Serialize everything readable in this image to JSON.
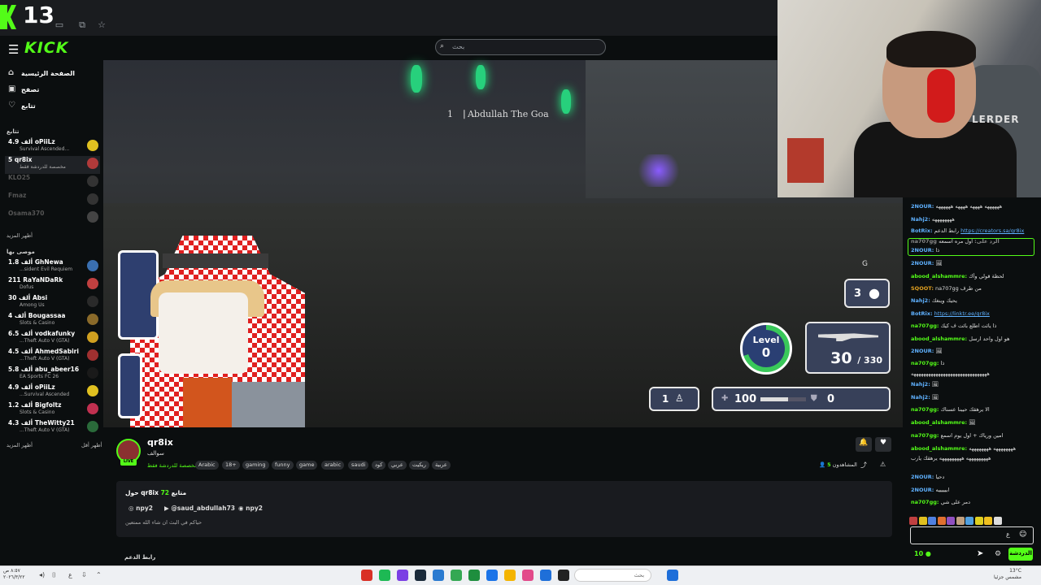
{
  "browser": {
    "tab_count": "13"
  },
  "header": {
    "logo": "KICK",
    "search_placeholder": "بحث"
  },
  "sidebar": {
    "nav": [
      {
        "label": "الصفحة الرئيسية",
        "icon": "home-icon"
      },
      {
        "label": "تصفح",
        "icon": "browse-icon"
      },
      {
        "label": "تتابع",
        "icon": "heart-icon"
      }
    ],
    "following_title": "تتابع",
    "following": [
      {
        "name": "4.9 ألف oPiiLz",
        "category": "Survival Ascended...",
        "avatar_color": "#e0c020",
        "offline": false,
        "selected": false
      },
      {
        "name": "5 qr8ix",
        "category": "مخصصة للدردشة فقط",
        "avatar_color": "#b03a3a",
        "offline": false,
        "selected": true
      },
      {
        "name": "KLO25",
        "category": "",
        "avatar_color": "#333",
        "offline": true,
        "selected": false
      },
      {
        "name": "Fmaz",
        "category": "",
        "avatar_color": "#333",
        "offline": true,
        "selected": false
      },
      {
        "name": "Osama370",
        "category": "",
        "avatar_color": "#444",
        "offline": true,
        "selected": false
      }
    ],
    "show_more_1": "أظهر المزيد",
    "recommended_title": "موصى بها",
    "recommended": [
      {
        "name": "1.8 ألف GhNewa",
        "category": "...sident Evil Requiem",
        "avatar_color": "#3a6fb0"
      },
      {
        "name": "211 RaYaNDaRk",
        "category": "Dofus",
        "avatar_color": "#c04040"
      },
      {
        "name": "30 ألف Absi",
        "category": "Among Us",
        "avatar_color": "#2a2a2a"
      },
      {
        "name": "4 ألف Bougassaa",
        "category": "Slots & Casino",
        "avatar_color": "#8a6a2a"
      },
      {
        "name": "6.5 ألف vodkafunky",
        "category": "...Theft Auto V (GTA)",
        "avatar_color": "#d0a020"
      },
      {
        "name": "4.5 ألف AhmedSabiri",
        "category": "...Theft Auto V (GTA)",
        "avatar_color": "#a03030"
      },
      {
        "name": "5.8 ألف abu_abeer16",
        "category": "EA Sports FC 26",
        "avatar_color": "#1a1a1a"
      },
      {
        "name": "4.9 ألف oPiiLz",
        "category": "...Survival Ascended",
        "avatar_color": "#e0c020"
      },
      {
        "name": "1.2 ألف Bigfoltz",
        "category": "Slots & Casino",
        "avatar_color": "#c03050"
      },
      {
        "name": "4.3 ألف TheWitty21",
        "category": "...Theft Auto V (GTA)",
        "avatar_color": "#2a6a3a"
      }
    ],
    "show_more_2": "أظهر المزيد",
    "show_less": "أظهر أقل"
  },
  "video": {
    "killfeed": "1 ⎹  Abdullah The Goa",
    "g_key": "G",
    "grenades": "3",
    "level_label": "Level",
    "level_value": "0",
    "level_progress": 0.7,
    "ammo": "30",
    "ammo_reserve": "/ 330",
    "team_count": "1",
    "health": "100",
    "health_fraction": 0.6,
    "armor": "0"
  },
  "channel": {
    "name": "qr8ix",
    "live_badge": "LIVE",
    "title": "سوالف",
    "category": "مخصصة للدردشة فقط",
    "tags": [
      "Arabic",
      "18+",
      "gaming",
      "funny",
      "game",
      "arabic",
      "saudi",
      "كود",
      "عربي",
      "ريكيت",
      "عربية"
    ],
    "viewers_label": "المشاهدون",
    "viewers": "5",
    "about_prefix": "حول",
    "about_name": "qr8ix",
    "followers_count": "72",
    "followers_label": "متابع",
    "socials": [
      {
        "label": "npy2",
        "icon": "instagram-icon"
      },
      {
        "label": "@saud_abdullah73",
        "icon": "youtube-icon"
      },
      {
        "label": "npy2",
        "icon": "discord-icon"
      }
    ],
    "bio": "حياكم في البث ان شاء الله ممتعين",
    "support_link": "رابط الدعم"
  },
  "chat": {
    "messages": [
      {
        "user": "2NOUR:",
        "text": "ههههههه ههههه ههههه ههههههه",
        "color": "#5fb1ff",
        "link": ""
      },
      {
        "user": "Nahj2:",
        "text": "ههههههههه",
        "color": "#5fb1ff",
        "link": ""
      },
      {
        "user": "BotRix:",
        "text": "رابط الدعم",
        "color": "#5fb1ff",
        "link": "https://creators.sa/qr8ix"
      },
      {
        "user": "na707gg الرد على:",
        "text": "اول مره اسمعه",
        "color": "#888",
        "link": ""
      },
      {
        "user": "2NOUR:",
        "text": "ذا",
        "color": "#5fb1ff",
        "link": ""
      },
      {
        "user": "2NOUR:",
        "text": "🖼",
        "color": "#5fb1ff",
        "link": ""
      },
      {
        "user": "abood_alshammre:",
        "text": "لحظة قولي وأك",
        "color": "#53fc18",
        "link": ""
      },
      {
        "user": "SQOOT:",
        "text": "na707gg من طرف",
        "color": "#e0a020",
        "link": ""
      },
      {
        "user": "Nahj2:",
        "text": "يحيك وينغك",
        "color": "#5fb1ff",
        "link": ""
      },
      {
        "user": "BotRix:",
        "text": "",
        "color": "#5fb1ff",
        "link": "https://linktr.ee/qr8ix"
      },
      {
        "user": "na707gg:",
        "text": "ذا يائت اطلع بائت ف كيك",
        "color": "#53fc18",
        "link": ""
      },
      {
        "user": "abood_alshammre:",
        "text": "هو اول واحد ارسل",
        "color": "#53fc18",
        "link": ""
      },
      {
        "user": "2NOUR:",
        "text": "🖼",
        "color": "#5fb1ff",
        "link": ""
      },
      {
        "user": "na707gg:",
        "text": "ذا",
        "color": "#53fc18",
        "link": ""
      },
      {
        "user": "",
        "text": "هههههههههههههههههههههههههههههههه",
        "color": "#ddd",
        "link": ""
      },
      {
        "user": "Nahj2:",
        "text": "🖼",
        "color": "#5fb1ff",
        "link": ""
      },
      {
        "user": "Nahj2:",
        "text": "🖼",
        "color": "#5fb1ff",
        "link": ""
      },
      {
        "user": "na707gg:",
        "text": "الا يرهقك حيبنا عسناك",
        "color": "#53fc18",
        "link": ""
      },
      {
        "user": "abood_alshammre:",
        "text": "🖼",
        "color": "#53fc18",
        "link": ""
      },
      {
        "user": "na707gg:",
        "text": "امين ورياك + اول يوم اسمع",
        "color": "#53fc18",
        "link": ""
      },
      {
        "user": "abood_alshammre:",
        "text": "ههههههههه ههههههههه",
        "color": "#53fc18",
        "link": ""
      },
      {
        "user": "",
        "text": "هههههههههه هههههههههه يرهقك يارب",
        "color": "#ddd",
        "link": ""
      },
      {
        "user": "2NOUR:",
        "text": "دحيا",
        "color": "#5fb1ff",
        "link": ""
      },
      {
        "user": "2NOUR:",
        "text": "ابيييييه",
        "color": "#5fb1ff",
        "link": ""
      },
      {
        "user": "na707gg:",
        "text": "دمر على شي",
        "color": "#53fc18",
        "link": ""
      }
    ],
    "input_text": "ع",
    "points": "10",
    "send_label": "الدردشة"
  },
  "webcam": {
    "brand_text": "LERDER"
  },
  "taskbar": {
    "time": "٨:٥٧ ص",
    "date": "٢٠٢٦/٣/٢٢",
    "search_placeholder": "بحث",
    "weather_temp": "13°C",
    "weather_desc": "مشمس جزئيا"
  }
}
